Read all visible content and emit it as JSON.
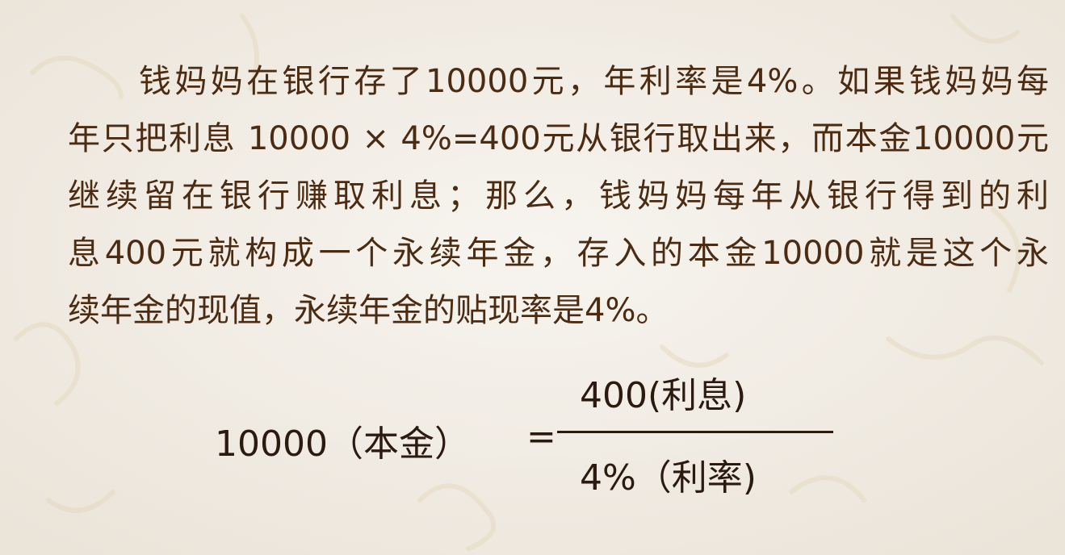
{
  "paragraph": {
    "lines": [
      "钱妈妈在银行存了10000元，年利率是4%。如果钱妈妈每",
      "年只把利息 10000 × 4%=400元从银行取出来，而本金10000元",
      "继续留在银行赚取利息；那么，钱妈妈每年从银行得到的利",
      "息400元就构成一个永续年金，存入的本金10000就是这个永",
      "续年金的现值，永续年金的贴现率是4%。"
    ]
  },
  "formula": {
    "lhs": "10000（本金）",
    "equals": "=",
    "numerator": "400(利息)",
    "denominator": "4%（利率)"
  },
  "colors": {
    "paragraph_text": "#4b2c12",
    "formula_text": "#2a1a10",
    "background": "#f3efe9"
  }
}
